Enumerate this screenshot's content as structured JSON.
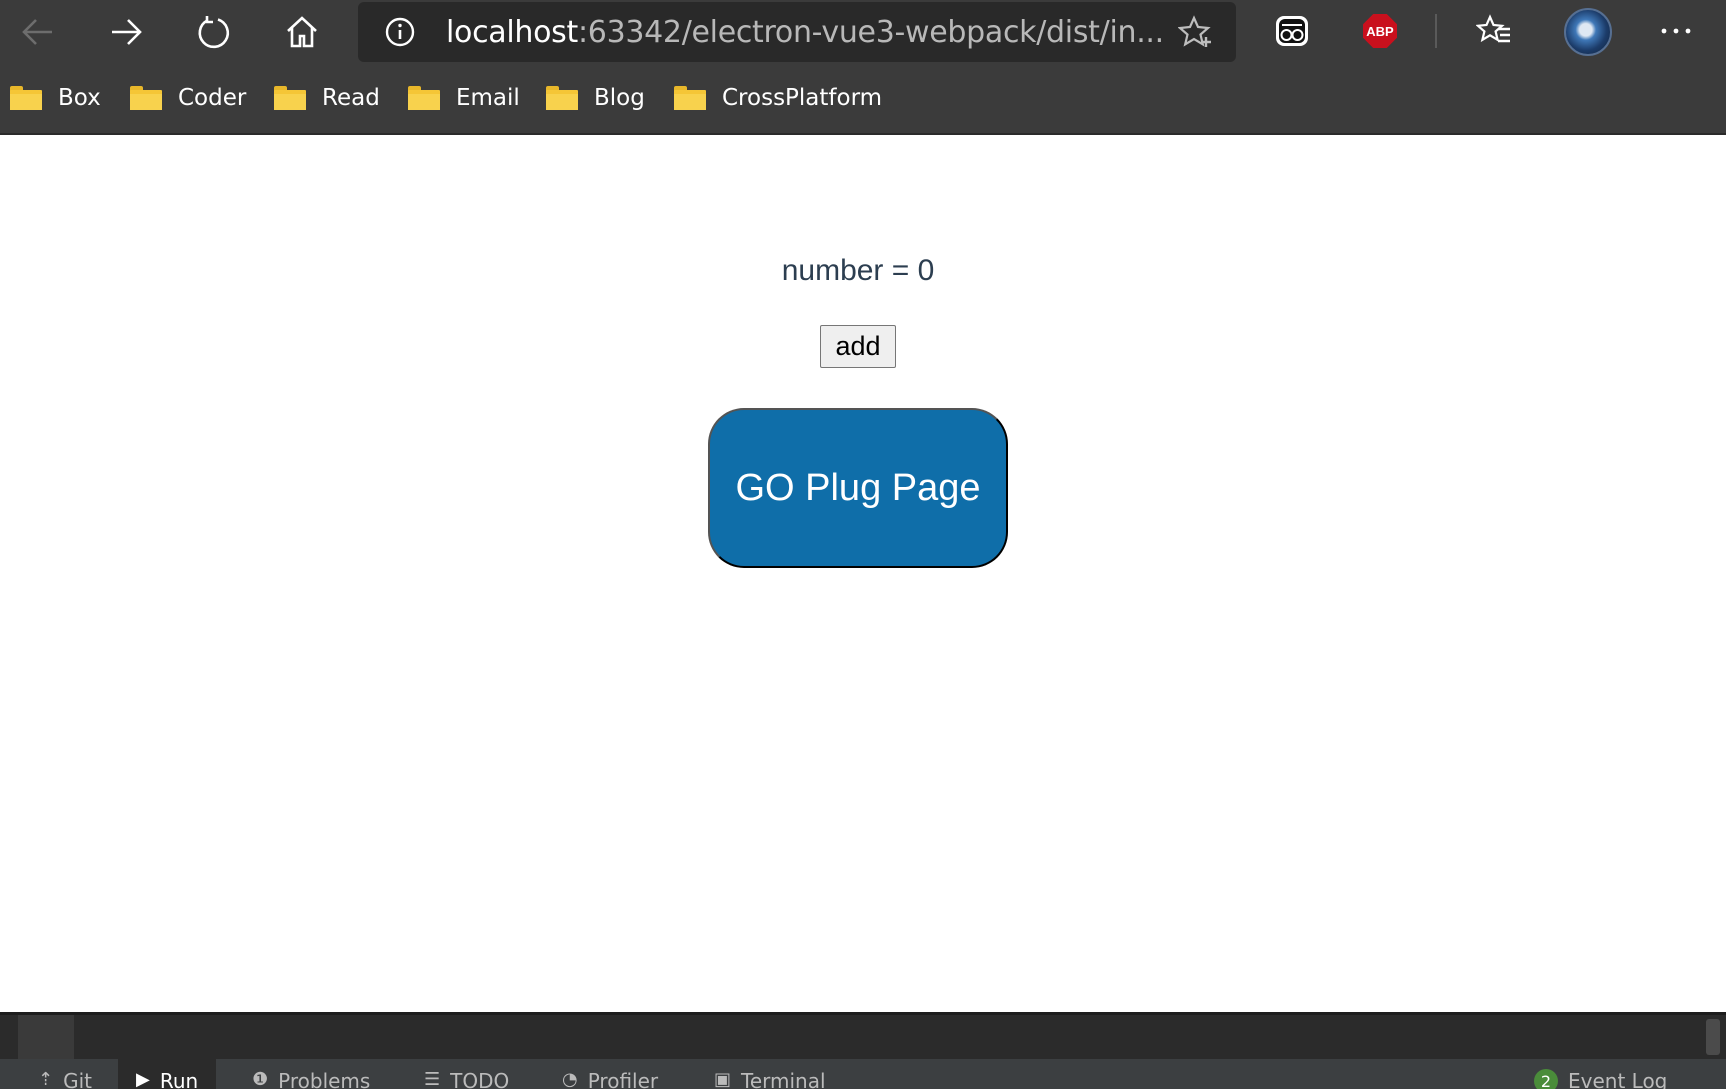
{
  "browser": {
    "url_host": "localhost",
    "url_rest": ":63342/electron-vue3-webpack/dist/in...",
    "icons": {
      "back": "arrow-left-icon",
      "forward": "arrow-right-icon",
      "refresh": "refresh-icon",
      "home": "home-icon",
      "info": "info-icon",
      "favorite": "star-plus-icon",
      "extension_reader": "reader-glasses-icon",
      "favorites_list": "favorites-list-icon",
      "more": "more-icon"
    },
    "abp_label": "ABP"
  },
  "bookmarks": [
    "Box",
    "Coder",
    "Read",
    "Email",
    "Blog",
    "CrossPlatform"
  ],
  "page": {
    "number_text": "number = 0",
    "add_label": "add",
    "go_label": "GO Plug Page"
  },
  "ide": {
    "tabs": [
      {
        "icon": "git-icon",
        "label": "Git"
      },
      {
        "icon": "run-icon",
        "label": "Run"
      },
      {
        "icon": "problems-icon",
        "label": "Problems"
      },
      {
        "icon": "todo-icon",
        "label": "TODO"
      },
      {
        "icon": "profiler-icon",
        "label": "Profiler"
      },
      {
        "icon": "terminal-icon",
        "label": "Terminal"
      }
    ],
    "event_log_count": "2",
    "event_log_label": "Event Log"
  },
  "colors": {
    "go_button": "#0f6ea9",
    "browser_chrome": "#3b3b3b",
    "abp": "#c9101d"
  }
}
